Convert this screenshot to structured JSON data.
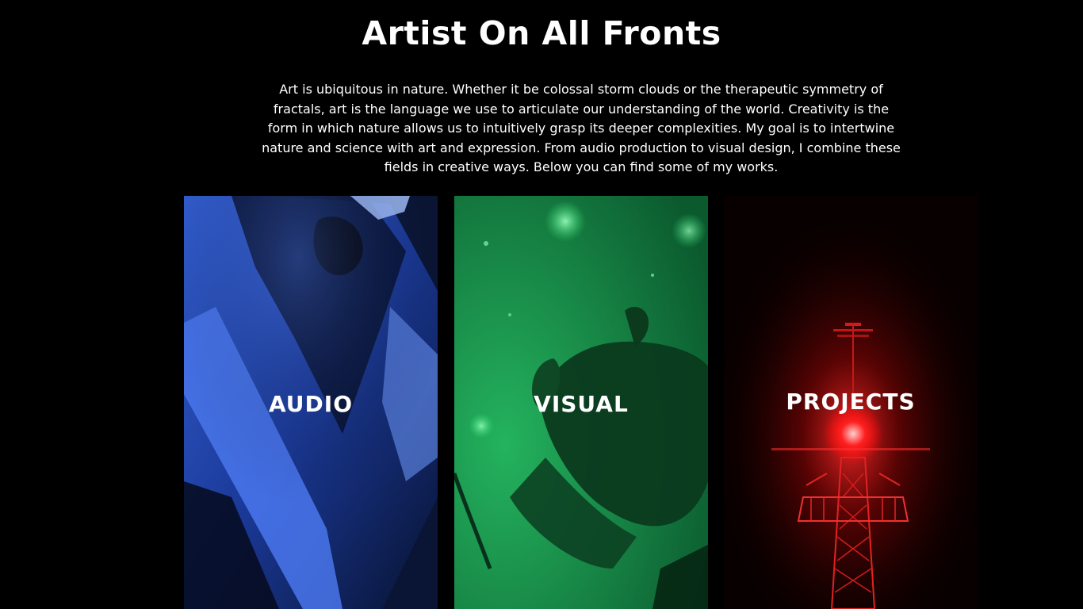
{
  "header": {
    "title": "Artist On All Fronts"
  },
  "intro": {
    "text": "Art is ubiquitous in nature. Whether it be colossal storm clouds or the therapeutic symmetry of fractals, art is the language we use to articulate our understanding of the world. Creativity is the form in which nature allows us to intuitively grasp its deeper complexities. My goal is to intertwine nature and science with art and expression. From audio production to visual design, I combine these fields in creative ways. Below you can find some of my works."
  },
  "cards": [
    {
      "label": "AUDIO",
      "color": "#2a5bd8"
    },
    {
      "label": "VISUAL",
      "color": "#1f9a52"
    },
    {
      "label": "PROJECTS",
      "color": "#e01010"
    }
  ]
}
